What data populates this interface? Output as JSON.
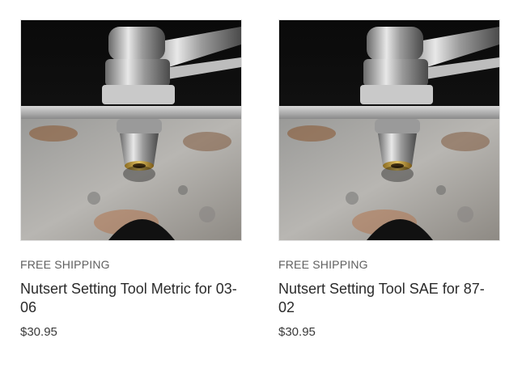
{
  "products": [
    {
      "shipping_badge": "FREE SHIPPING",
      "title": "Nutsert Setting Tool Metric for 03-06",
      "price": "$30.95",
      "image_alt": "Nutsert setting tool installed in steel frame"
    },
    {
      "shipping_badge": "FREE SHIPPING",
      "title": "Nutsert Setting Tool SAE for 87-02",
      "price": "$30.95",
      "image_alt": "Nutsert setting tool installed in steel frame"
    }
  ]
}
